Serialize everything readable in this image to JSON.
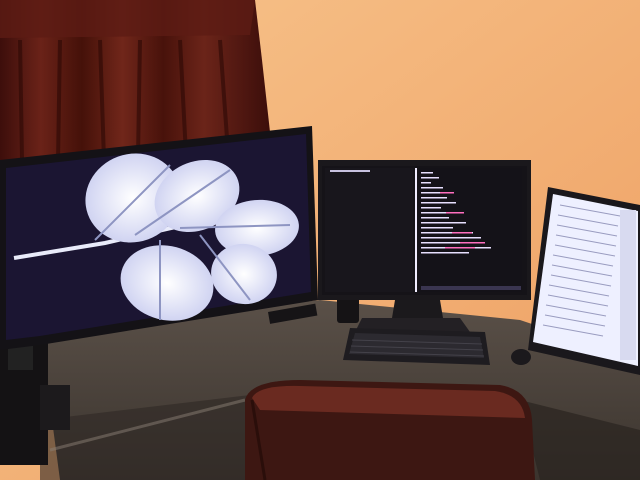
{
  "scene": {
    "objects": [
      {
        "name": "curtain",
        "color": "#5a1a14"
      },
      {
        "name": "wall",
        "color": "#f2b477"
      },
      {
        "name": "desk",
        "color": "#4a3f36"
      },
      {
        "name": "tv-left",
        "screen": "leaf-wallpaper"
      },
      {
        "name": "monitor-center",
        "screen": "terminal-split"
      },
      {
        "name": "monitor-right-portrait",
        "screen": "document"
      },
      {
        "name": "keyboard"
      },
      {
        "name": "mouse"
      },
      {
        "name": "chair"
      },
      {
        "name": "speaker"
      },
      {
        "name": "pc-tower"
      }
    ],
    "colors": {
      "wall": "#f2b477",
      "wall_light": "#f7c58d",
      "curtain": "#5a1a14",
      "curtain_dark": "#3a0d0a",
      "desk": "#4e453c",
      "tv_frame": "#151318",
      "tv_screen": "#1a1430",
      "leaf": "#dfe2f4",
      "leaf_vein": "#9aa0c8",
      "terminal_bg": "#15131a",
      "terminal_text": "#e8e0ff",
      "terminal_pink": "#ff6fbf",
      "doc_bg": "#f4f4ff",
      "chair": "#4a1e18"
    }
  }
}
